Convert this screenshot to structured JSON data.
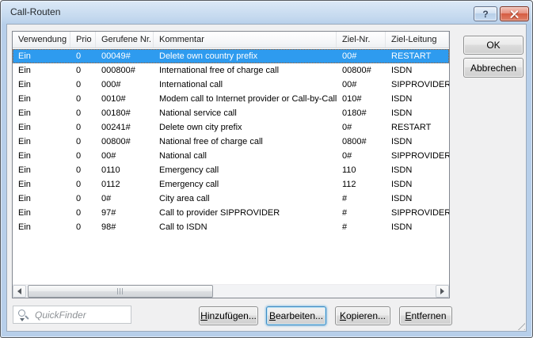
{
  "window": {
    "title": "Call-Routen"
  },
  "titlebar": {
    "help_label": "?"
  },
  "table": {
    "columns": [
      {
        "label": "Verwendung"
      },
      {
        "label": "Prio"
      },
      {
        "label": "Gerufene Nr."
      },
      {
        "label": "Kommentar"
      },
      {
        "label": "Ziel-Nr."
      },
      {
        "label": "Ziel-Leitung"
      }
    ],
    "rows": [
      {
        "verwendung": "Ein",
        "prio": "0",
        "gerufene_nr": "00049#",
        "kommentar": "Delete own country prefix",
        "ziel_nr": "00#",
        "ziel_leitung": "RESTART",
        "selected": true
      },
      {
        "verwendung": "Ein",
        "prio": "0",
        "gerufene_nr": "000800#",
        "kommentar": "International free of charge call",
        "ziel_nr": "00800#",
        "ziel_leitung": "ISDN"
      },
      {
        "verwendung": "Ein",
        "prio": "0",
        "gerufene_nr": "000#",
        "kommentar": "International call",
        "ziel_nr": "00#",
        "ziel_leitung": "SIPPROVIDER"
      },
      {
        "verwendung": "Ein",
        "prio": "0",
        "gerufene_nr": "0010#",
        "kommentar": "Modem call to Internet provider or Call-by-Call",
        "ziel_nr": "010#",
        "ziel_leitung": "ISDN"
      },
      {
        "verwendung": "Ein",
        "prio": "0",
        "gerufene_nr": "00180#",
        "kommentar": "National service call",
        "ziel_nr": "0180#",
        "ziel_leitung": "ISDN"
      },
      {
        "verwendung": "Ein",
        "prio": "0",
        "gerufene_nr": "00241#",
        "kommentar": "Delete own city prefix",
        "ziel_nr": "0#",
        "ziel_leitung": "RESTART"
      },
      {
        "verwendung": "Ein",
        "prio": "0",
        "gerufene_nr": "00800#",
        "kommentar": "National free of charge call",
        "ziel_nr": "0800#",
        "ziel_leitung": "ISDN"
      },
      {
        "verwendung": "Ein",
        "prio": "0",
        "gerufene_nr": "00#",
        "kommentar": "National call",
        "ziel_nr": "0#",
        "ziel_leitung": "SIPPROVIDER"
      },
      {
        "verwendung": "Ein",
        "prio": "0",
        "gerufene_nr": "0110",
        "kommentar": "Emergency call",
        "ziel_nr": "110",
        "ziel_leitung": "ISDN"
      },
      {
        "verwendung": "Ein",
        "prio": "0",
        "gerufene_nr": "0112",
        "kommentar": "Emergency call",
        "ziel_nr": "112",
        "ziel_leitung": "ISDN"
      },
      {
        "verwendung": "Ein",
        "prio": "0",
        "gerufene_nr": "0#",
        "kommentar": "City area call",
        "ziel_nr": "#",
        "ziel_leitung": "ISDN"
      },
      {
        "verwendung": "Ein",
        "prio": "0",
        "gerufene_nr": "97#",
        "kommentar": "Call to provider SIPPROVIDER",
        "ziel_nr": "#",
        "ziel_leitung": "SIPPROVIDER"
      },
      {
        "verwendung": "Ein",
        "prio": "0",
        "gerufene_nr": "98#",
        "kommentar": "Call to ISDN",
        "ziel_nr": "#",
        "ziel_leitung": "ISDN"
      }
    ]
  },
  "side_buttons": {
    "ok": "OK",
    "cancel": "Abbrechen"
  },
  "action_buttons": {
    "add": "Hinzufügen...",
    "edit": "Bearbeiten...",
    "copy": "Kopieren...",
    "remove": "Entfernen"
  },
  "quickfinder": {
    "placeholder": "QuickFinder"
  },
  "colors": {
    "selection_bg": "#2E9BEF",
    "selection_text": "#FFFFFF",
    "close_button": "#D55A40"
  }
}
